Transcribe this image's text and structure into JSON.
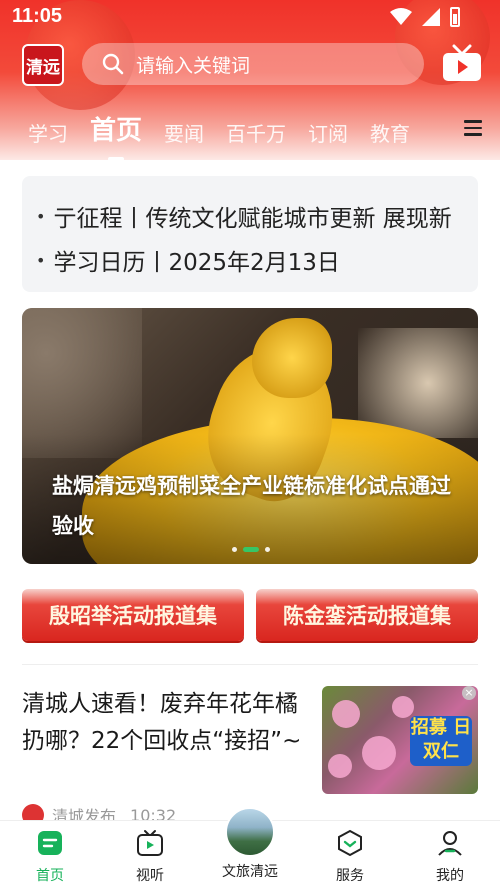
{
  "status_bar": {
    "time": "11:05"
  },
  "header": {
    "logo_text": "清远",
    "search": {
      "placeholder": "请输入关键词"
    },
    "tabs": [
      {
        "label": "学习",
        "active": false
      },
      {
        "label": "首页",
        "active": true
      },
      {
        "label": "要闻",
        "active": false
      },
      {
        "label": "百千万",
        "active": false
      },
      {
        "label": "订阅",
        "active": false
      },
      {
        "label": "教育",
        "active": false
      }
    ]
  },
  "ticker": {
    "lines": [
      "亍征程丨传统文化赋能城市更新 展现新",
      "学习日历丨2025年2月13日"
    ]
  },
  "banner": {
    "title": "盐焗清远鸡预制菜全产业链标准化试点通过验收",
    "dots": 3,
    "active_dot": 1
  },
  "specials": [
    {
      "label": "殷昭举活动报道集"
    },
    {
      "label": "陈金銮活动报道集"
    }
  ],
  "news": {
    "title": "清城人速看！废弃年花年橘扔哪？22个回收点“接招”~",
    "source": "清城发布",
    "time": "10:32",
    "thumb_badge": "招募 日双仁"
  },
  "tabbar": [
    {
      "label": "首页",
      "icon": "home-icon",
      "active": true
    },
    {
      "label": "视听",
      "icon": "video-icon",
      "active": false
    },
    {
      "label": "文旅清远",
      "icon": "culture-avatar",
      "active": false
    },
    {
      "label": "服务",
      "icon": "service-icon",
      "active": false
    },
    {
      "label": "我的",
      "icon": "user-icon",
      "active": false
    }
  ],
  "colors": {
    "brand_red": "#f0322a",
    "active_green": "#17b25a"
  }
}
